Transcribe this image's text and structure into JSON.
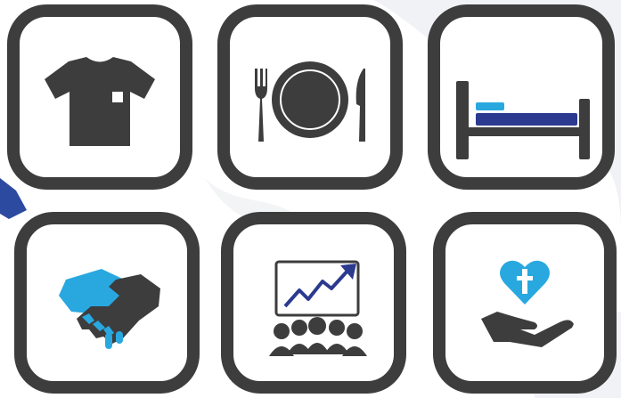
{
  "colors": {
    "tile_border": "#3d3d3d",
    "icon_dark": "#3d3d3d",
    "accent_light_blue": "#29a8e0",
    "accent_navy": "#2b3a8f",
    "background": "#ffffff",
    "background_swirl": "#eef0f3",
    "left_edge_fragment": "#2b4aa0"
  },
  "tiles": [
    {
      "icon": "t-shirt-icon"
    },
    {
      "icon": "plate-fork-knife-icon"
    },
    {
      "icon": "bed-icon"
    },
    {
      "icon": "handshake-icon"
    },
    {
      "icon": "presentation-audience-icon"
    },
    {
      "icon": "heart-cross-hand-icon"
    }
  ]
}
